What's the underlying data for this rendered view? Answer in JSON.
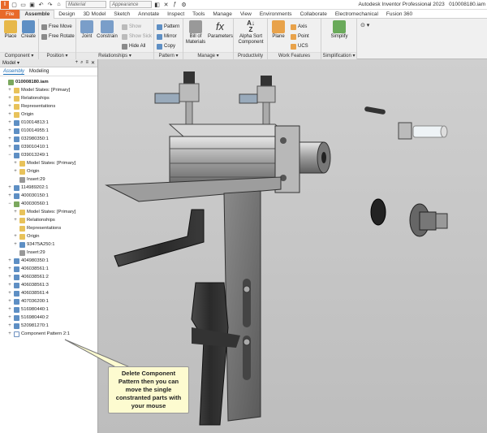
{
  "title": {
    "app": "Autodesk Inventor Professional 2023",
    "file": "010008180.iam",
    "material_placeholder": "Material",
    "appearance_placeholder": "Appearance"
  },
  "menu": {
    "file": "File",
    "tabs": [
      "Assemble",
      "Design",
      "3D Model",
      "Sketch",
      "Annotate",
      "Inspect",
      "Tools",
      "Manage",
      "View",
      "Environments",
      "Collaborate",
      "Electromechanical",
      "Fusion 360"
    ]
  },
  "ribbon": {
    "component": {
      "label": "Component ▾",
      "place": "Place",
      "create": "Create"
    },
    "position": {
      "label": "Position ▾",
      "free_move": "Free Move",
      "free_rotate": "Free Rotate"
    },
    "relationships": {
      "label": "Relationships ▾",
      "joint": "Joint",
      "constrain": "Constrain",
      "show": "Show",
      "show_sick": "Show Sick",
      "hide_all": "Hide All"
    },
    "pattern": {
      "label": "Pattern ▾",
      "pattern": "Pattern",
      "mirror": "Mirror",
      "copy": "Copy"
    },
    "manage": {
      "label": "Manage ▾",
      "bom": "Bill of Materials",
      "parameters": "Parameters"
    },
    "productivity": {
      "label": "Productivity",
      "alpha_sort": "Alpha Sort Component"
    },
    "work_features": {
      "label": "Work Features",
      "plane": "Plane",
      "axis": "Axis",
      "point": "Point",
      "ucs": "UCS"
    },
    "simplification": {
      "label": "Simplification ▾",
      "simplify": "Simplify"
    }
  },
  "browser": {
    "header": "Model ▾",
    "tabs": [
      "Assembly",
      "Modeling"
    ],
    "tree": [
      {
        "label": "010008180.iam",
        "indent": 0,
        "icon": "asm",
        "exp": ""
      },
      {
        "label": "Model States: [Primary]",
        "indent": 1,
        "icon": "folder",
        "exp": "+"
      },
      {
        "label": "Relationships",
        "indent": 1,
        "icon": "folder",
        "exp": "+"
      },
      {
        "label": "Representations",
        "indent": 1,
        "icon": "folder",
        "exp": "+"
      },
      {
        "label": "Origin",
        "indent": 1,
        "icon": "folder",
        "exp": "+"
      },
      {
        "label": "010014813:1",
        "indent": 1,
        "icon": "part",
        "exp": "+"
      },
      {
        "label": "010014955:1",
        "indent": 1,
        "icon": "part",
        "exp": "+"
      },
      {
        "label": "032980350:1",
        "indent": 1,
        "icon": "part",
        "exp": "+"
      },
      {
        "label": "039010410:1",
        "indent": 1,
        "icon": "part",
        "exp": "+"
      },
      {
        "label": "039013249:1",
        "indent": 1,
        "icon": "part",
        "exp": "−"
      },
      {
        "label": "Model States: [Primary]",
        "indent": 2,
        "icon": "folder",
        "exp": "+"
      },
      {
        "label": "Origin",
        "indent": 2,
        "icon": "folder",
        "exp": "+"
      },
      {
        "label": "Insert:29",
        "indent": 2,
        "icon": "insert",
        "exp": ""
      },
      {
        "label": "114989202:1",
        "indent": 1,
        "icon": "part",
        "exp": "+"
      },
      {
        "label": "400030150:1",
        "indent": 1,
        "icon": "part",
        "exp": "+"
      },
      {
        "label": "400030560:1",
        "indent": 1,
        "icon": "asm",
        "exp": "−"
      },
      {
        "label": "Model States: [Primary]",
        "indent": 2,
        "icon": "folder",
        "exp": "+"
      },
      {
        "label": "Relationships",
        "indent": 2,
        "icon": "folder",
        "exp": "+"
      },
      {
        "label": "Representations",
        "indent": 2,
        "icon": "folder",
        "exp": ""
      },
      {
        "label": "Origin",
        "indent": 2,
        "icon": "folder",
        "exp": "+"
      },
      {
        "label": "93475A250:1",
        "indent": 2,
        "icon": "part",
        "exp": "+"
      },
      {
        "label": "Insert:29",
        "indent": 2,
        "icon": "insert",
        "exp": ""
      },
      {
        "label": "404980350:1",
        "indent": 1,
        "icon": "part",
        "exp": "+"
      },
      {
        "label": "406038561:1",
        "indent": 1,
        "icon": "part",
        "exp": "+"
      },
      {
        "label": "406038561:2",
        "indent": 1,
        "icon": "part",
        "exp": "+"
      },
      {
        "label": "406038561:3",
        "indent": 1,
        "icon": "part",
        "exp": "+"
      },
      {
        "label": "406038561:4",
        "indent": 1,
        "icon": "part",
        "exp": "+"
      },
      {
        "label": "407036200:1",
        "indent": 1,
        "icon": "part",
        "exp": "+"
      },
      {
        "label": "516980440:1",
        "indent": 1,
        "icon": "part",
        "exp": "+"
      },
      {
        "label": "516980440:2",
        "indent": 1,
        "icon": "part",
        "exp": "+"
      },
      {
        "label": "520981270:1",
        "indent": 1,
        "icon": "part",
        "exp": "+"
      },
      {
        "label": "Component Pattern 2:1",
        "indent": 1,
        "icon": "cpat",
        "exp": "+"
      }
    ]
  },
  "callout": {
    "text": "Delete Component Pattern then you can move the single constranted parts with your mouse"
  },
  "colors": {
    "file_orange": "#e8692a",
    "callout_bg": "#fdfbd0",
    "selection_blue": "#1a6db5"
  }
}
